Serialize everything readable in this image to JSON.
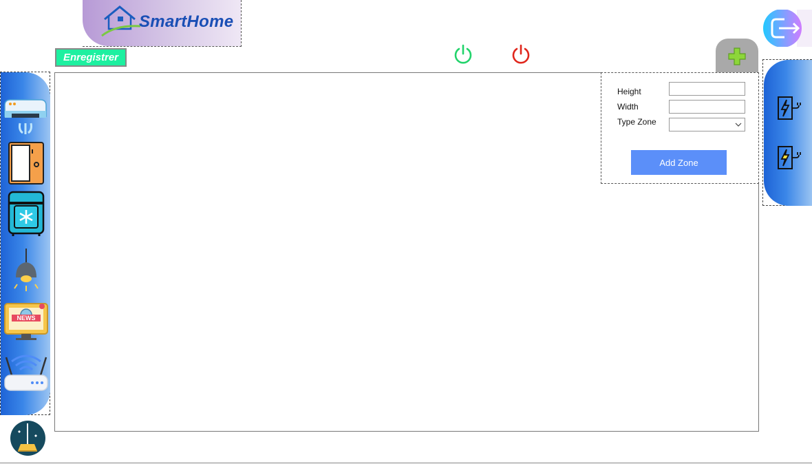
{
  "app": {
    "logo_text": "SmartHome"
  },
  "toolbar": {
    "save_label": "Enregistrer"
  },
  "power": {
    "on_color": "#22d36b",
    "off_color": "#e0261c"
  },
  "sidebar": {
    "devices": [
      {
        "icon": "air-conditioner-icon"
      },
      {
        "icon": "door-icon"
      },
      {
        "icon": "fridge-icon"
      },
      {
        "icon": "lamp-icon"
      },
      {
        "icon": "news-tv-icon"
      },
      {
        "icon": "wifi-router-icon"
      }
    ]
  },
  "zone_form": {
    "height_label": "Height",
    "height_value": "",
    "width_label": "Width",
    "width_value": "",
    "type_label": "Type Zone",
    "type_value": "",
    "add_label": "Add Zone"
  },
  "right_sidebar": {
    "items": [
      {
        "icon": "power-socket-icon"
      },
      {
        "icon": "power-socket-active-icon"
      }
    ]
  },
  "colors": {
    "accent": "#1df0a0",
    "sidebar_blue": "#2f77e0",
    "add_zone_button": "#5b8ff9",
    "add_tab": "#a9a9a9",
    "plus": "#8dd63a"
  }
}
